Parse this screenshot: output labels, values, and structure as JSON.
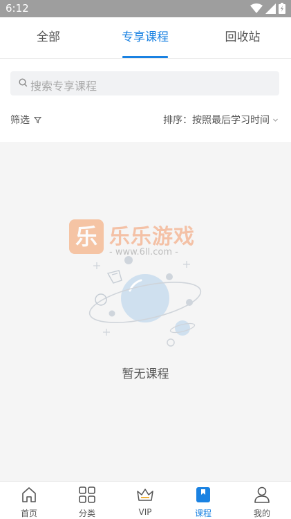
{
  "status_bar": {
    "time": "6:12"
  },
  "tabs": [
    {
      "label": "全部"
    },
    {
      "label": "专享课程"
    },
    {
      "label": "回收站"
    }
  ],
  "search": {
    "placeholder": "搜索专享课程"
  },
  "filter": {
    "label": "筛选"
  },
  "sort": {
    "label": "排序：按照最后学习时间"
  },
  "watermark": {
    "title": "乐乐游戏",
    "url": "- www.6ll.com -",
    "logo": "乐"
  },
  "empty_state": {
    "text": "暂无课程"
  },
  "bottom_nav": [
    {
      "label": "首页",
      "icon": "home-icon"
    },
    {
      "label": "分类",
      "icon": "grid-icon"
    },
    {
      "label": "VIP",
      "icon": "crown-icon"
    },
    {
      "label": "课程",
      "icon": "bookmark-icon"
    },
    {
      "label": "我的",
      "icon": "user-icon"
    }
  ],
  "colors": {
    "accent": "#1a82e2",
    "statusbar": "#9e9e9e"
  }
}
